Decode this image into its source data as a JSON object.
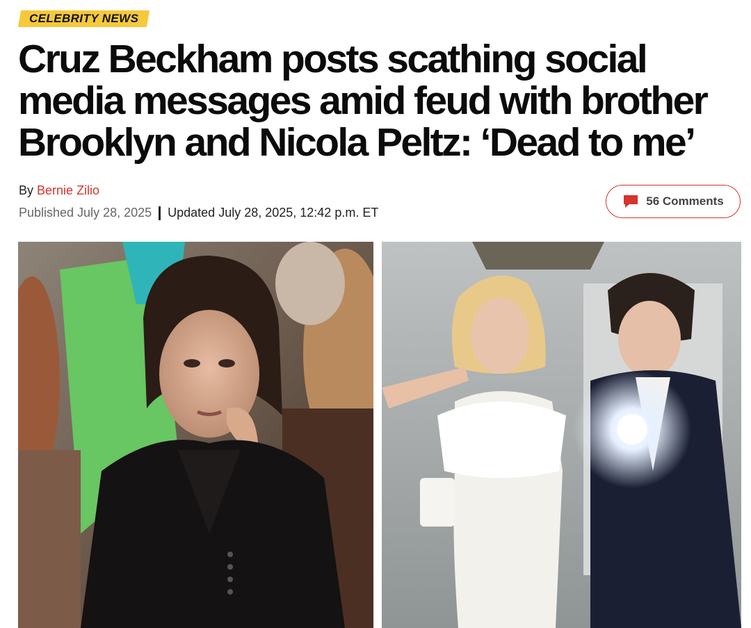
{
  "article": {
    "category": "CELEBRITY NEWS",
    "headline": "Cruz Beckham posts scathing social media messages amid feud with brother Brooklyn and Nicola Peltz: ‘Dead to me’",
    "byline_prefix": "By",
    "author": "Bernie Zilio",
    "published": "Published July 28, 2025",
    "updated": "Updated July 28, 2025, 12:42 p.m. ET",
    "comments_label": "56 Comments"
  },
  "icons": {
    "comments": "speech-bubble-icon"
  },
  "colors": {
    "category_bg": "#f5c93a",
    "accent_red": "#d6342c",
    "headline": "#0b0b0b",
    "meta_gray": "#666666"
  },
  "images": [
    {
      "name": "woman-dark-blazer-photo"
    },
    {
      "name": "couple-mirror-selfie-photo"
    }
  ]
}
